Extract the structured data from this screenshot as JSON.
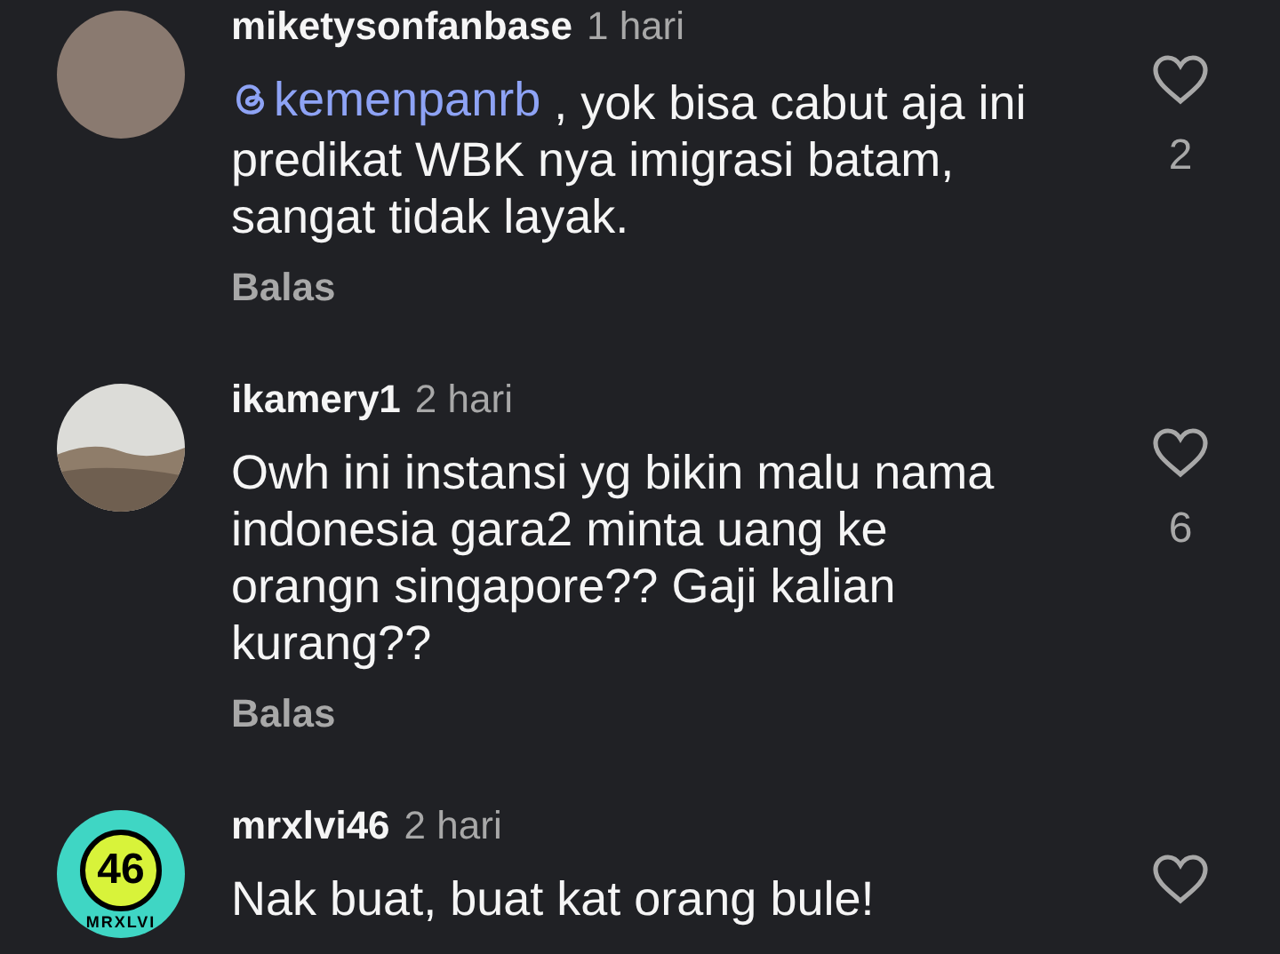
{
  "comments": [
    {
      "username": "miketysonfanbase",
      "time": "1 hari",
      "avatar": {
        "kind": "photo"
      },
      "mention": "kemenpanrb",
      "text": " , yok bisa cabut aja ini predikat WBK nya imigrasi batam, sangat tidak layak.",
      "likes": "2",
      "reply": "Balas"
    },
    {
      "username": "ikamery1",
      "time": "2 hari",
      "avatar": {
        "kind": "landscape"
      },
      "text": "Owh ini instansi yg bikin malu nama indonesia gara2 minta uang ke orangn singapore?? Gaji kalian kurang??",
      "likes": "6",
      "reply": "Balas"
    },
    {
      "username": "mrxlvi46",
      "time": "2 hari",
      "avatar": {
        "kind": "badge",
        "label": "46",
        "caption": "MRXLVI"
      },
      "text": "Nak buat, buat kat orang bule!"
    }
  ]
}
